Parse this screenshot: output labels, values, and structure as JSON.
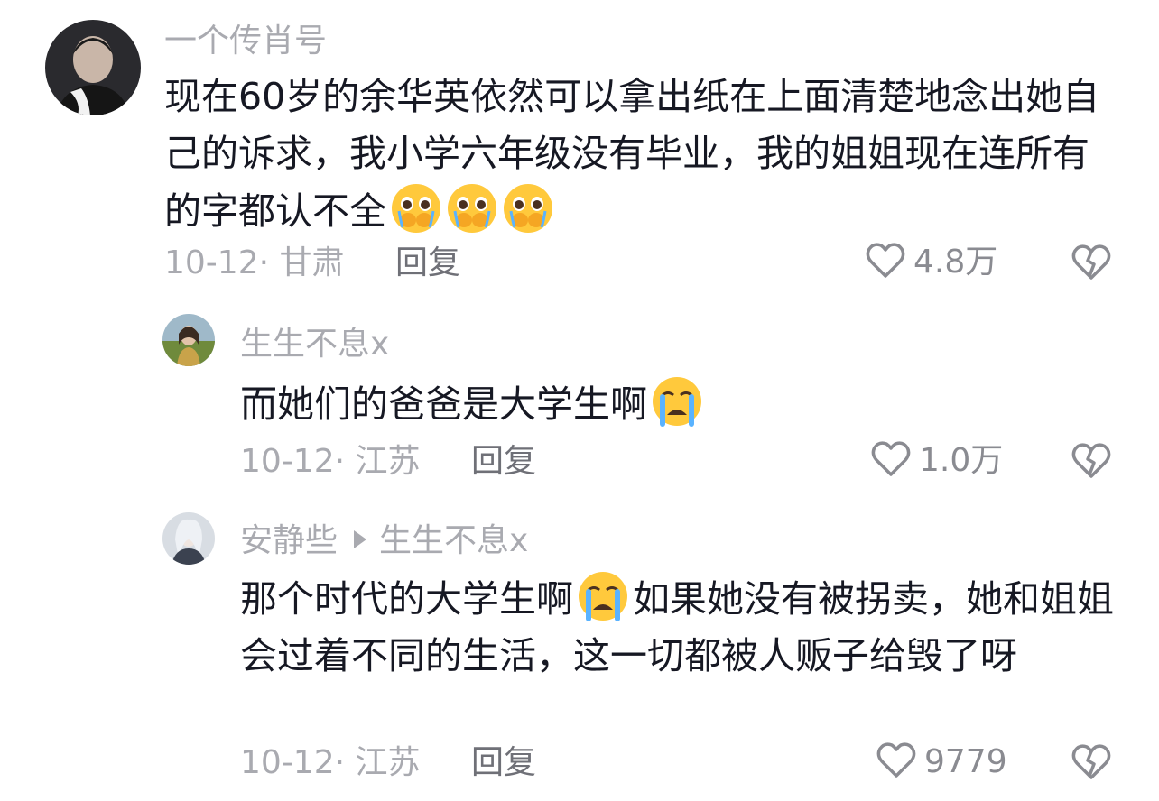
{
  "comments": [
    {
      "username": "一个传肖号",
      "text": "现在60岁的余华英依然可以拿出纸在上面清楚地念出她自己的诉求，我小学六年级没有毕业，我的姐姐现在连所有的字都认不全",
      "emoji": [
        "pleading-face-emoji",
        "pleading-face-emoji",
        "pleading-face-emoji"
      ],
      "date_location": "10-12· 甘肃",
      "reply_label": "回复",
      "likes": "4.8万"
    },
    {
      "username": "生生不息x",
      "text": "而她们的爸爸是大学生啊",
      "emoji": [
        "crying-face-emoji"
      ],
      "date_location": "10-12· 江苏",
      "reply_label": "回复",
      "likes": "1.0万"
    },
    {
      "username": "安静些",
      "reply_to": "生生不息x",
      "text_part1": "那个时代的大学生啊",
      "text_part2": "如果她没有被拐卖，她和姐姐会过着不同的生活，这一切都被人贩子给毁了呀",
      "emoji": [
        "crying-face-emoji"
      ],
      "date_location": "10-12· 江苏",
      "reply_label": "回复",
      "likes": "9779"
    }
  ],
  "icons": {
    "like": "heart-outline-icon",
    "dislike": "broken-heart-icon"
  },
  "colors": {
    "text_primary": "#161823",
    "text_secondary": "#a9aab0",
    "reply_link": "#6f7077",
    "emoji_yellow": "#ffc93c"
  }
}
